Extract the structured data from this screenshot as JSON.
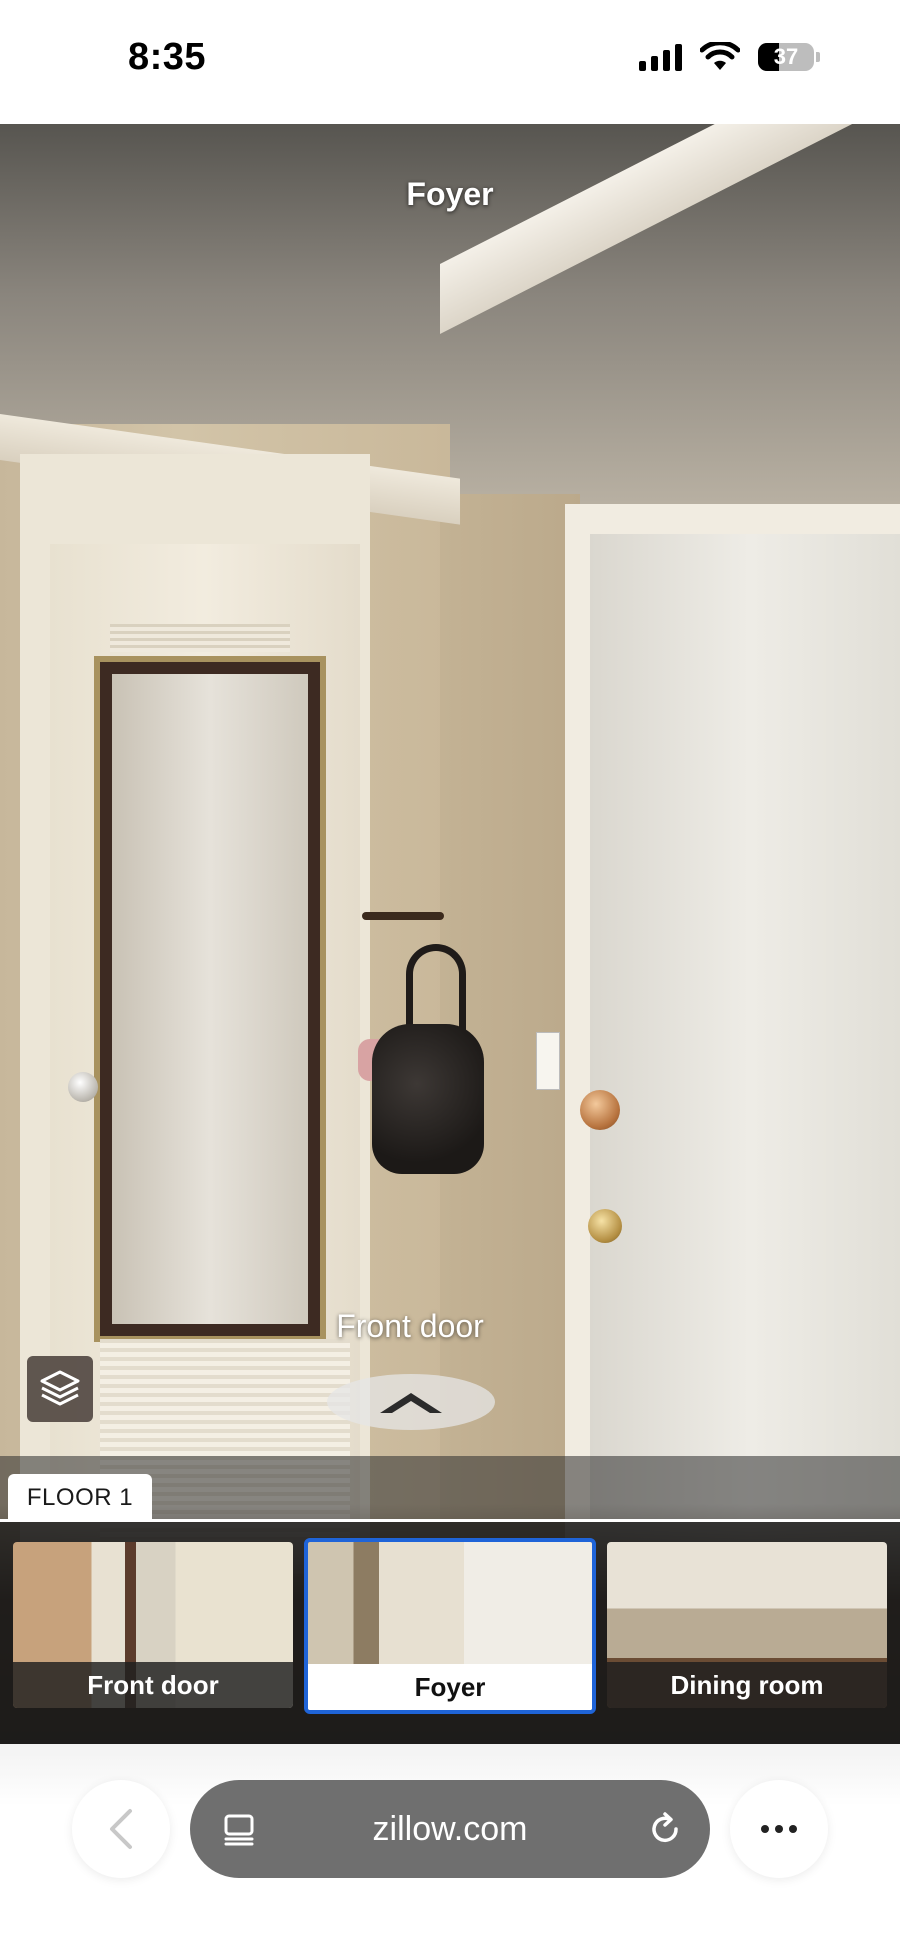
{
  "status_bar": {
    "time": "8:35",
    "battery_level": "37",
    "icons": [
      "signal-icon",
      "wifi-icon",
      "battery-icon"
    ]
  },
  "viewer": {
    "room_title": "Foyer",
    "hotspot_label": "Front door",
    "hotspot_icon": "chevron-up-icon",
    "layers_icon": "layers-icon"
  },
  "floor_tab": {
    "label": "FLOOR 1"
  },
  "thumbnails": [
    {
      "label": "Front door",
      "active": false
    },
    {
      "label": "Foyer",
      "active": true
    },
    {
      "label": "Dining room",
      "active": false
    }
  ],
  "browser": {
    "url": "zillow.com",
    "back_icon": "chevron-left-icon",
    "tab_icon": "tab-overview-icon",
    "reload_icon": "reload-icon",
    "more_icon": "more-horizontal-icon"
  },
  "colors": {
    "active_thumb_border": "#1f64d8",
    "url_pill": "#6f6f6f"
  }
}
